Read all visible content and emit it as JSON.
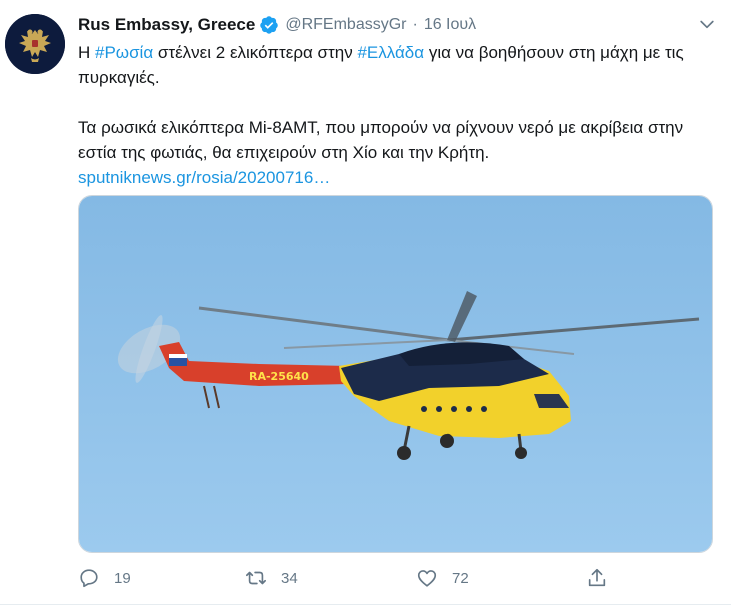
{
  "tweet": {
    "author_name": "Rus Embassy, Greece",
    "verified": true,
    "handle": "@RFEmbassyGr",
    "separator": "·",
    "date": "16 Ιουλ",
    "line1_prefix": "Η ",
    "hashtag1": "#Ρωσία",
    "line1_mid": " στέλνει 2 ελικόπτερα στην ",
    "hashtag2": "#Ελλάδα",
    "line1_suffix": " για να βοηθήσουν στη μάχη με τις πυρκαγιές.",
    "paragraph2": "Τα ρωσικά ελικόπτερα Mi-8AMT, που μπορούν να ρίχνουν νερό με ακρίβεια στην εστία της φωτιάς, θα επιχειρούν στη Χίο και την Κρήτη.",
    "link_text": "sputniknews.gr/rosia/20200716…",
    "media": {
      "registration": "RA-25640",
      "sky_color": "#8cbfe6"
    },
    "actions": {
      "reply_count": "19",
      "retweet_count": "34",
      "like_count": "72"
    }
  },
  "colors": {
    "link": "#1b95e0",
    "muted": "#657786",
    "text": "#14171a",
    "verified_badge": "#1da1f2"
  }
}
